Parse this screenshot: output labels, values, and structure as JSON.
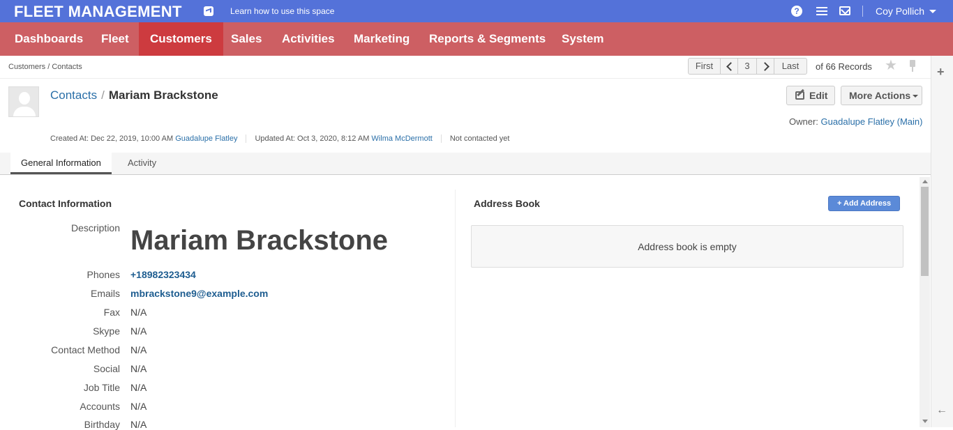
{
  "topbar": {
    "app_title": "FLEET MANAGEMENT",
    "learn_link": "Learn how to use this space",
    "help_glyph": "?",
    "user_name": "Coy Pollich"
  },
  "nav": {
    "items": [
      "Dashboards",
      "Fleet",
      "Customers",
      "Sales",
      "Activities",
      "Marketing",
      "Reports & Segments",
      "System"
    ],
    "active": "Customers"
  },
  "breadcrumb": "Customers / Contacts",
  "pager": {
    "first": "First",
    "current_page": "3",
    "last": "Last",
    "records": "of 66 Records"
  },
  "header": {
    "section_link": "Contacts",
    "separator": "/",
    "contact_name": "Mariam Brackstone",
    "edit_label": "Edit",
    "more_actions_label": "More Actions",
    "owner_label": "Owner:",
    "owner_value": "Guadalupe Flatley (Main)",
    "created_label": "Created At: Dec 22, 2019, 10:00 AM",
    "created_by": "Guadalupe Flatley",
    "updated_label": "Updated At: Oct 3, 2020, 8:12 AM",
    "updated_by": "Wilma McDermott",
    "contact_status": "Not contacted yet"
  },
  "tabs": [
    "General Information",
    "Activity"
  ],
  "contact_info": {
    "title": "Contact Information",
    "fields": [
      {
        "label": "Description",
        "value": "Mariam Brackstone"
      },
      {
        "label": "Phones",
        "value": "+18982323434"
      },
      {
        "label": "Emails",
        "value": "mbrackstone9@example.com"
      },
      {
        "label": "Fax",
        "value": "N/A"
      },
      {
        "label": "Skype",
        "value": "N/A"
      },
      {
        "label": "Contact Method",
        "value": "N/A"
      },
      {
        "label": "Social",
        "value": "N/A"
      },
      {
        "label": "Job Title",
        "value": "N/A"
      },
      {
        "label": "Accounts",
        "value": "N/A"
      },
      {
        "label": "Birthday",
        "value": "N/A"
      }
    ]
  },
  "address_book": {
    "title": "Address Book",
    "add_label": "+ Add Address",
    "empty_text": "Address book is empty"
  },
  "side": {
    "plus_glyph": "+",
    "arrow_glyph": "←",
    "star_glyph": "★"
  }
}
